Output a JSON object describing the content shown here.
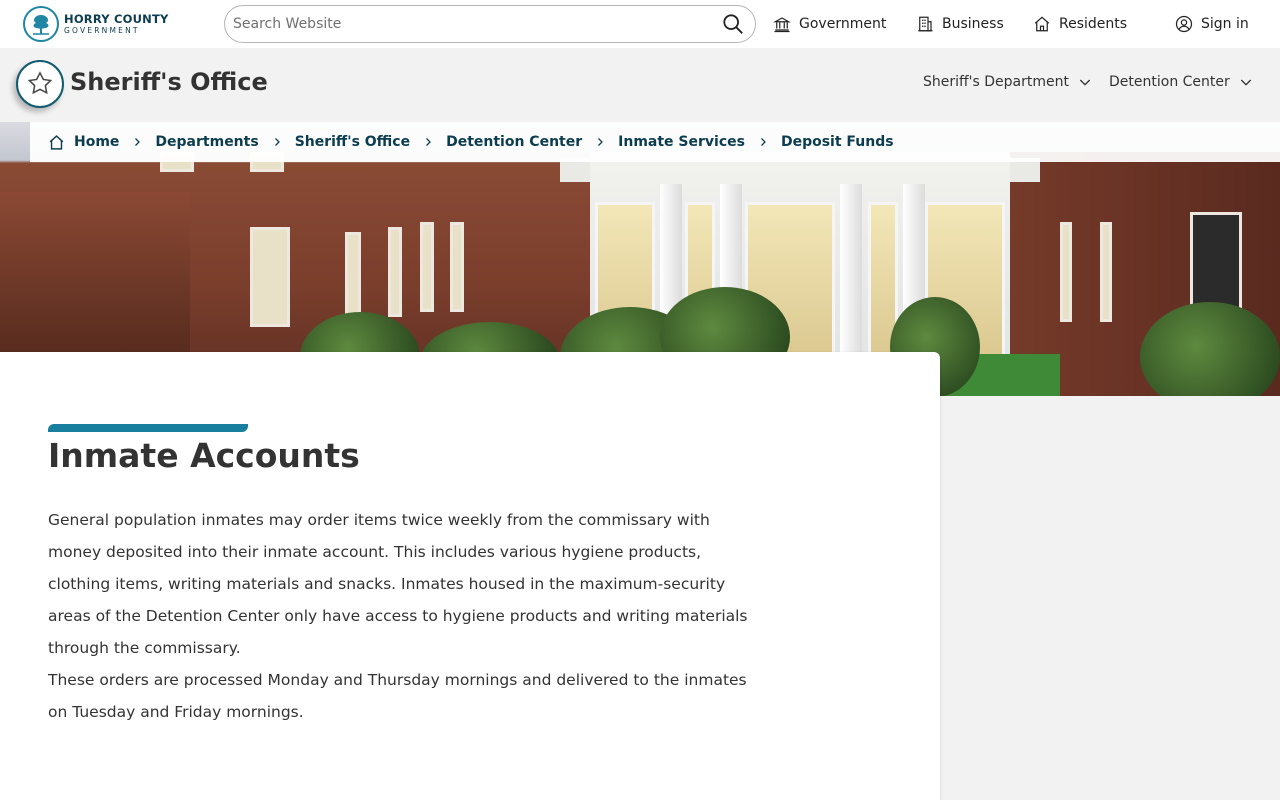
{
  "top": {
    "logo": {
      "line1": "HORRY COUNTY",
      "line2": "GOVERNMENT"
    },
    "search": {
      "placeholder": "Search Website"
    },
    "nav": [
      {
        "label": "Government",
        "icon": "building-columns-icon"
      },
      {
        "label": "Business",
        "icon": "office-building-icon"
      },
      {
        "label": "Residents",
        "icon": "house-icon"
      },
      {
        "label": "Sign in",
        "icon": "user-circle-icon"
      }
    ]
  },
  "department": {
    "title": "Sheriff's Office",
    "icon": "sheriff-star-icon",
    "nav": [
      {
        "label": "Sheriff's Department"
      },
      {
        "label": "Detention Center"
      }
    ]
  },
  "breadcrumb": [
    {
      "label": "Home"
    },
    {
      "label": "Departments"
    },
    {
      "label": "Sheriff's Office"
    },
    {
      "label": "Detention Center"
    },
    {
      "label": "Inmate Services"
    },
    {
      "label": "Deposit Funds"
    }
  ],
  "content": {
    "title": "Inmate Accounts",
    "paragraph1": "General population inmates may order items twice weekly from the commissary with money deposited into their inmate account. This includes various hygiene products, clothing items, writing materials and snacks. Inmates housed in the maximum-security areas of the Detention Center only have access to hygiene products and writing materials through the commissary.",
    "paragraph2": "These orders are processed Monday and Thursday mornings and delivered to the inmates on Tuesday and Friday mornings."
  },
  "colors": {
    "accent": "#187f9e",
    "navy": "#0c3c4f",
    "background": "#f2f2f2"
  }
}
